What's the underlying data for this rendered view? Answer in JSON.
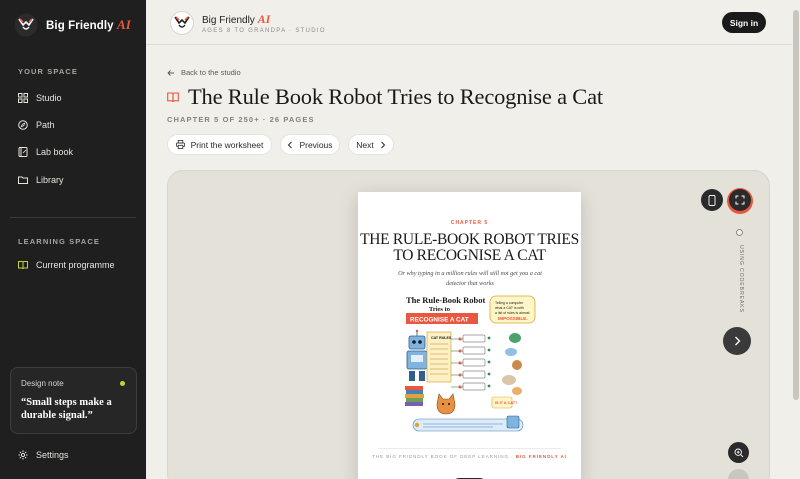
{
  "sidebar": {
    "brand": {
      "name": "Big Friendly ",
      "ai": "AI"
    },
    "section_your_space": "YOUR SPACE",
    "items": [
      {
        "label": "Studio",
        "icon": "grid-icon"
      },
      {
        "label": "Path",
        "icon": "compass-icon"
      },
      {
        "label": "Lab book",
        "icon": "notebook-icon"
      },
      {
        "label": "Library",
        "icon": "folder-icon"
      }
    ],
    "section_learning_space": "LEARNING SPACE",
    "learning_items": [
      {
        "label": "Current programme",
        "icon": "open-book-icon"
      }
    ],
    "design_note": {
      "label": "Design note",
      "quote": "“Small steps make a durable signal.”"
    },
    "settings": {
      "label": "Settings",
      "icon": "gear-icon"
    }
  },
  "header": {
    "title": "Big Friendly ",
    "title_ai": "AI",
    "subtitle": "AGES 8 TO GRANDPA · STUDIO",
    "signin": "Sign in"
  },
  "main": {
    "back_link": "Back to the studio",
    "title": "The Rule Book Robot Tries to Recognise a Cat",
    "chapter_meta": "CHAPTER 5 OF 250+ · 26 PAGES",
    "actions": {
      "print": "Print the worksheet",
      "previous": "Previous",
      "next": "Next"
    }
  },
  "worksheet": {
    "chapter": "CHAPTER 5",
    "title_line1": "THE RULE-BOOK ROBOT TRIES",
    "title_line2": "TO RECOGNISE A CAT",
    "subtitle": "Or why typing in a million rules will still not get you a cat detector that works",
    "illustration": {
      "headline_1": "The Rule-Book Robot",
      "headline_2": "Tries to",
      "headline_3": "RECOGNISE A CAT",
      "callout": "Telling a computer what a CAT is with a list of rules is almost IMPOSSIBLE."
    },
    "footer_main": "THE BIG FRIENDLY BOOK OF DEEP LEARNING · ",
    "footer_highlight": "BIG FRIENDLY AI"
  },
  "viewer": {
    "side_label": "USING CODEBREAKS",
    "colors": {
      "accent": "#e8573f",
      "dark": "#2a2a2a"
    }
  }
}
